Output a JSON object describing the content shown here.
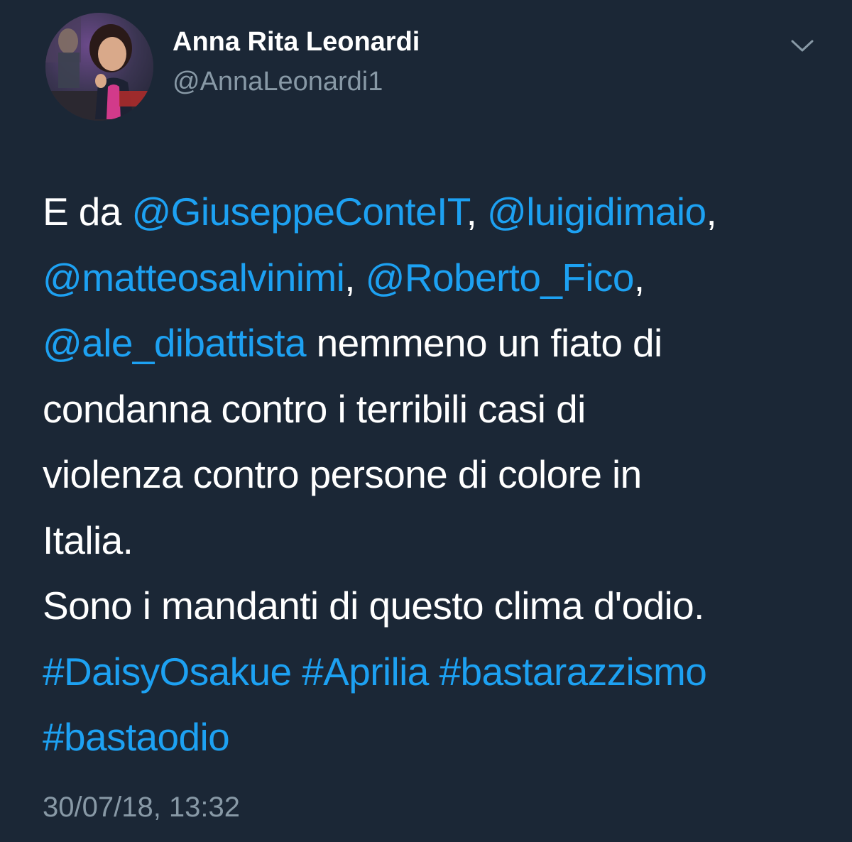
{
  "tweet": {
    "author": {
      "name": "Anna Rita Leonardi",
      "handle": "@AnnaLeonardi1",
      "avatar_icon": "profile-photo"
    },
    "menu_icon": "chevron-down-icon",
    "text": {
      "l1_a": "E da ",
      "m_conte": "@GiuseppeConteIT",
      "l1_b": ", ",
      "m_dimaio": "@luigidimaio",
      "l1_c": ",",
      "m_salvini": "@matteosalvinimi",
      "l2_a": ", ",
      "m_fico": "@Roberto_Fico",
      "l2_b": ",",
      "m_dibattista": "@ale_dibattista",
      "l3_a": " nemmeno un fiato di",
      "l4": "condanna contro i terribili casi di",
      "l5": "violenza contro persone di colore in",
      "l6": "Italia.",
      "l7": "Sono i mandanti di questo clima d'odio.",
      "h_daisy": "#DaisyOsakue",
      "sp1": " ",
      "h_aprilia": "#Aprilia",
      "sp2": " ",
      "h_basta_razz": "#bastarazzismo",
      "h_basta_odio": "#bastaodio"
    },
    "timestamp": "30/07/18, 13:32"
  },
  "colors": {
    "background": "#1b2736",
    "link": "#1da1f2",
    "secondary_text": "#8899a6",
    "primary_text": "#ffffff"
  }
}
